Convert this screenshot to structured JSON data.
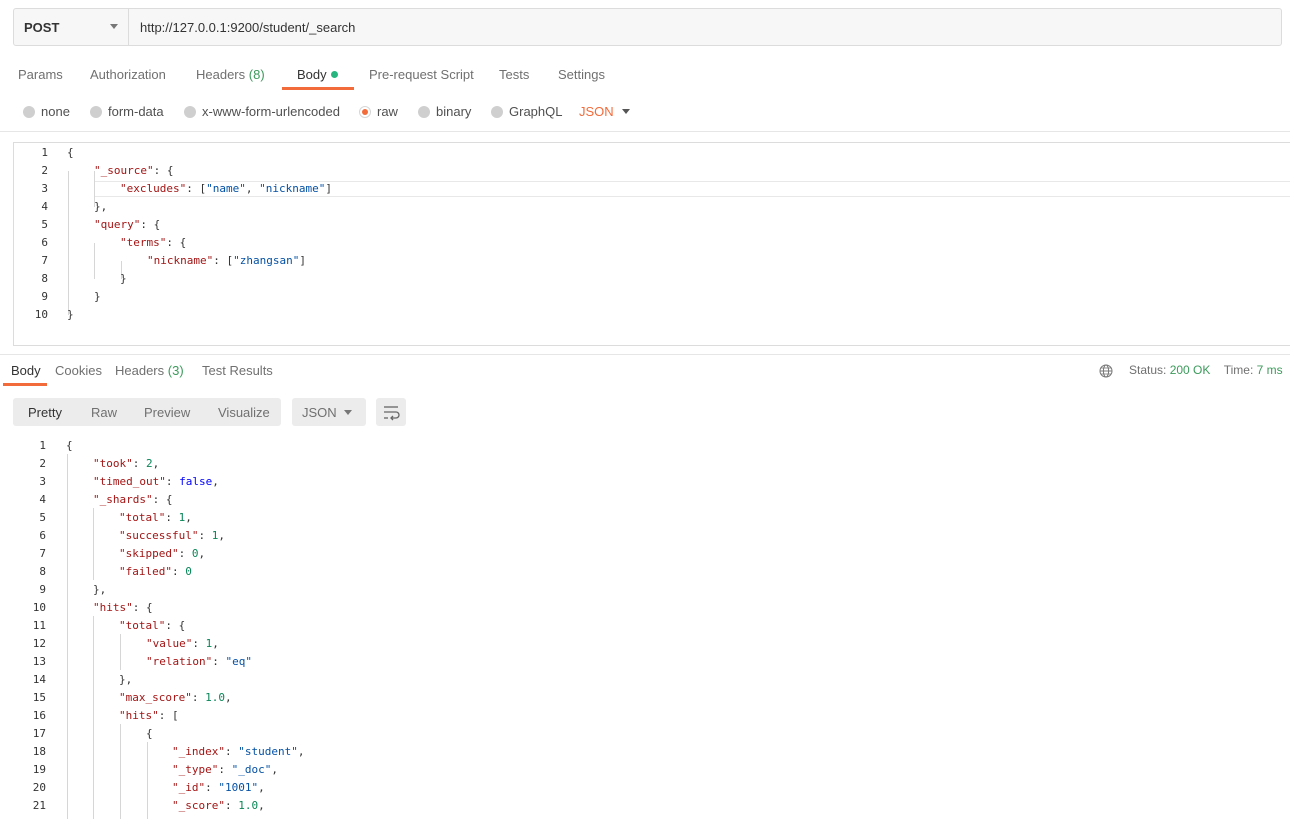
{
  "request": {
    "method": "POST",
    "url": "http://127.0.0.1:9200/student/_search"
  },
  "request_tabs": {
    "params": "Params",
    "authorization": "Authorization",
    "headers": "Headers",
    "headers_count": "(8)",
    "body": "Body",
    "prerequest": "Pre-request Script",
    "tests": "Tests",
    "settings": "Settings"
  },
  "body_types": {
    "none": "none",
    "form_data": "form-data",
    "urlencoded": "x-www-form-urlencoded",
    "raw": "raw",
    "binary": "binary",
    "graphql": "GraphQL",
    "format": "JSON"
  },
  "response_tabs": {
    "body": "Body",
    "cookies": "Cookies",
    "headers": "Headers",
    "headers_count": "(3)",
    "test_results": "Test Results"
  },
  "status": {
    "status_label": "Status:",
    "status_value": "200 OK",
    "time_label": "Time:",
    "time_value": "7 ms"
  },
  "response_toolbar": {
    "pretty": "Pretty",
    "raw": "Raw",
    "preview": "Preview",
    "visualize": "Visualize",
    "format": "JSON"
  },
  "colors": {
    "accent": "#f26b3a",
    "success": "#3c9b5b"
  },
  "icons": {
    "globe": "globe-icon",
    "wrap": "wrap-lines-icon",
    "caret": "chevron-down-icon"
  }
}
